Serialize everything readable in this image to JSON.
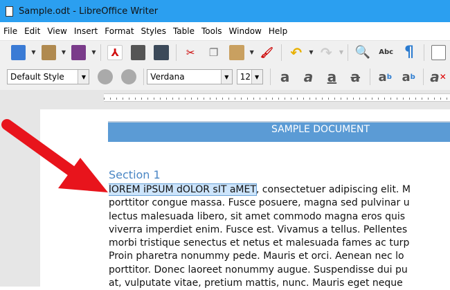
{
  "window": {
    "title": "Sample.odt - LibreOffice Writer"
  },
  "menu": [
    "File",
    "Edit",
    "View",
    "Insert",
    "Format",
    "Styles",
    "Table",
    "Tools",
    "Window",
    "Help"
  ],
  "toolbar2": {
    "paragraph_style": "Default Style",
    "font_name": "Verdana",
    "font_size": "12"
  },
  "document": {
    "header": "SAMPLE DOCUMENT",
    "section_heading": "Section 1",
    "selected_text": "lOREM iPSUM dOLOR sIT aMET",
    "first_line_rest": ", consectetuer adipiscing elit. M",
    "lines": [
      "porttitor congue massa. Fusce posuere, magna sed pulvinar u",
      "lectus malesuada libero, sit amet commodo magna eros quis",
      "viverra imperdiet enim. Fusce est. Vivamus a tellus. Pellentes",
      "morbi tristique senectus et netus et malesuada fames ac turp",
      "Proin pharetra nonummy pede. Mauris et orci. Aenean nec lo",
      "porttitor. Donec laoreet nonummy augue. Suspendisse dui pu",
      "at, vulputate vitae, pretium mattis, nunc. Mauris eget neque"
    ]
  },
  "colors": {
    "titlebar": "#2b9ff0",
    "header_bar": "#5b9bd5",
    "heading": "#4a86c4",
    "arrow": "#e8141c"
  }
}
